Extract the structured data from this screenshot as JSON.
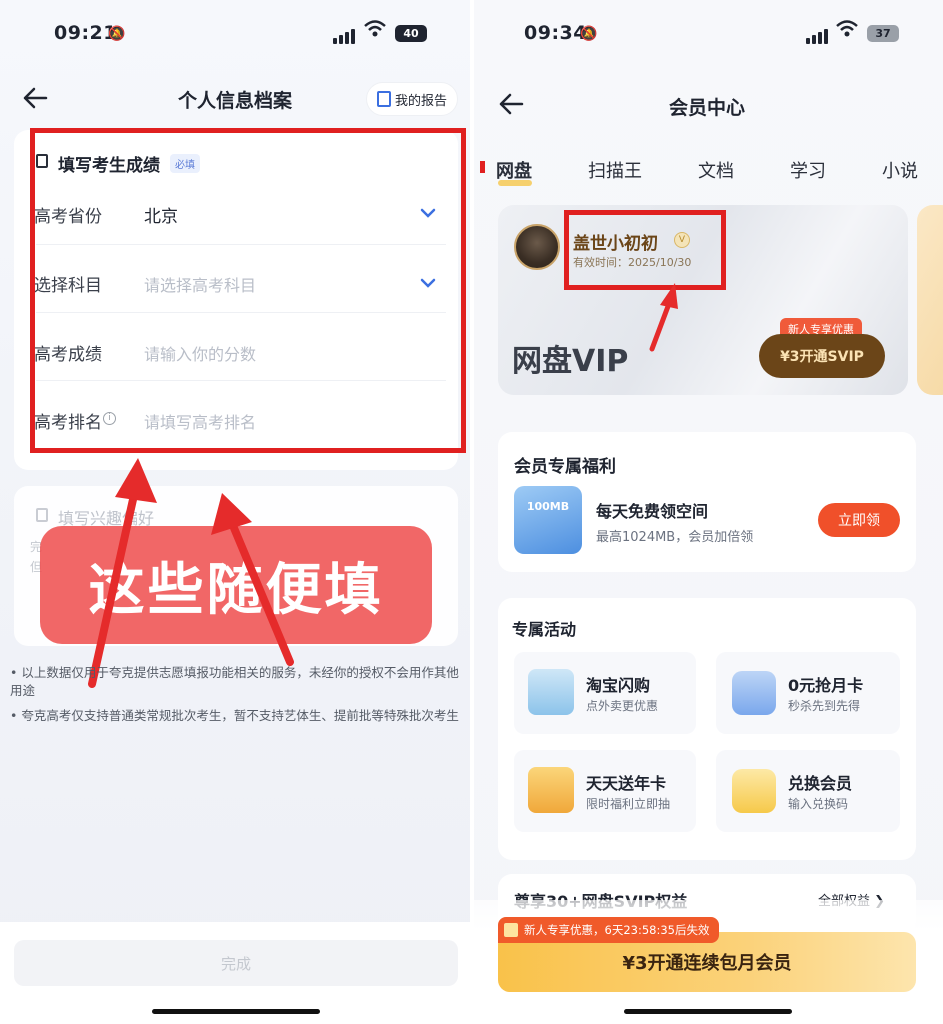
{
  "left": {
    "status": {
      "time": "09:21",
      "battery": "40"
    },
    "nav": {
      "title": "个人信息档案",
      "report": "我的报告"
    },
    "section1": {
      "title": "填写考生成绩",
      "badge": "必填"
    },
    "fields": [
      {
        "label": "高考省份",
        "value": "北京",
        "placeholder": ""
      },
      {
        "label": "选择科目",
        "value": "",
        "placeholder": "请选择高考科目"
      },
      {
        "label": "高考成绩",
        "value": "",
        "placeholder": "请输入你的分数"
      },
      {
        "label": "高考排名",
        "value": "",
        "placeholder": "请填写高考排名"
      }
    ],
    "section2": {
      "title": "填写兴趣偏好",
      "line1": "完",
      "line2": "但"
    },
    "annotation": "这些随便填",
    "notes": [
      "• 以上数据仅用于夸克提供志愿填报功能相关的服务，未经你的授权不会用作其他用途",
      "• 夸克高考仅支持普通类常规批次考生，暂不支持艺体生、提前批等特殊批次考生"
    ],
    "done": "完成"
  },
  "right": {
    "status": {
      "time": "09:34",
      "battery": "37"
    },
    "nav": {
      "title": "会员中心"
    },
    "tabs": [
      "网盘",
      "扫描王",
      "文档",
      "学习",
      "小说"
    ],
    "user": {
      "name": "盖世小初初",
      "expiry": "有效时间：2025/10/30"
    },
    "vip_title": "网盘VIP",
    "promo_tag": "新人专享优惠",
    "promo_button": "¥3开通SVIP",
    "benefits": {
      "title": "会员专属福利",
      "icon_text": "100MB",
      "item_title": "每天免费领空间",
      "item_sub": "最高1024MB，会员加倍领",
      "claim": "立即领"
    },
    "activities": {
      "title": "专属活动",
      "items": [
        {
          "title": "淘宝闪购",
          "sub": "点外卖更优惠"
        },
        {
          "title": "0元抢月卡",
          "sub": "秒杀先到先得"
        },
        {
          "title": "天天送年卡",
          "sub": "限时福利立即抽"
        },
        {
          "title": "兑换会员",
          "sub": "输入兑换码"
        }
      ]
    },
    "rights": {
      "title": "尊享30+网盘SVIP权益",
      "link": "全部权益 ❯"
    },
    "bottom": {
      "countdown": "新人专享优惠，6天23:58:35后失效",
      "cta": "¥3开通连续包月会员"
    }
  },
  "colors": {
    "annotation_red": "#e02020",
    "accent_blue": "#3b6fe0",
    "vip_brown": "#6b4518",
    "claim_orange": "#f0502a"
  }
}
